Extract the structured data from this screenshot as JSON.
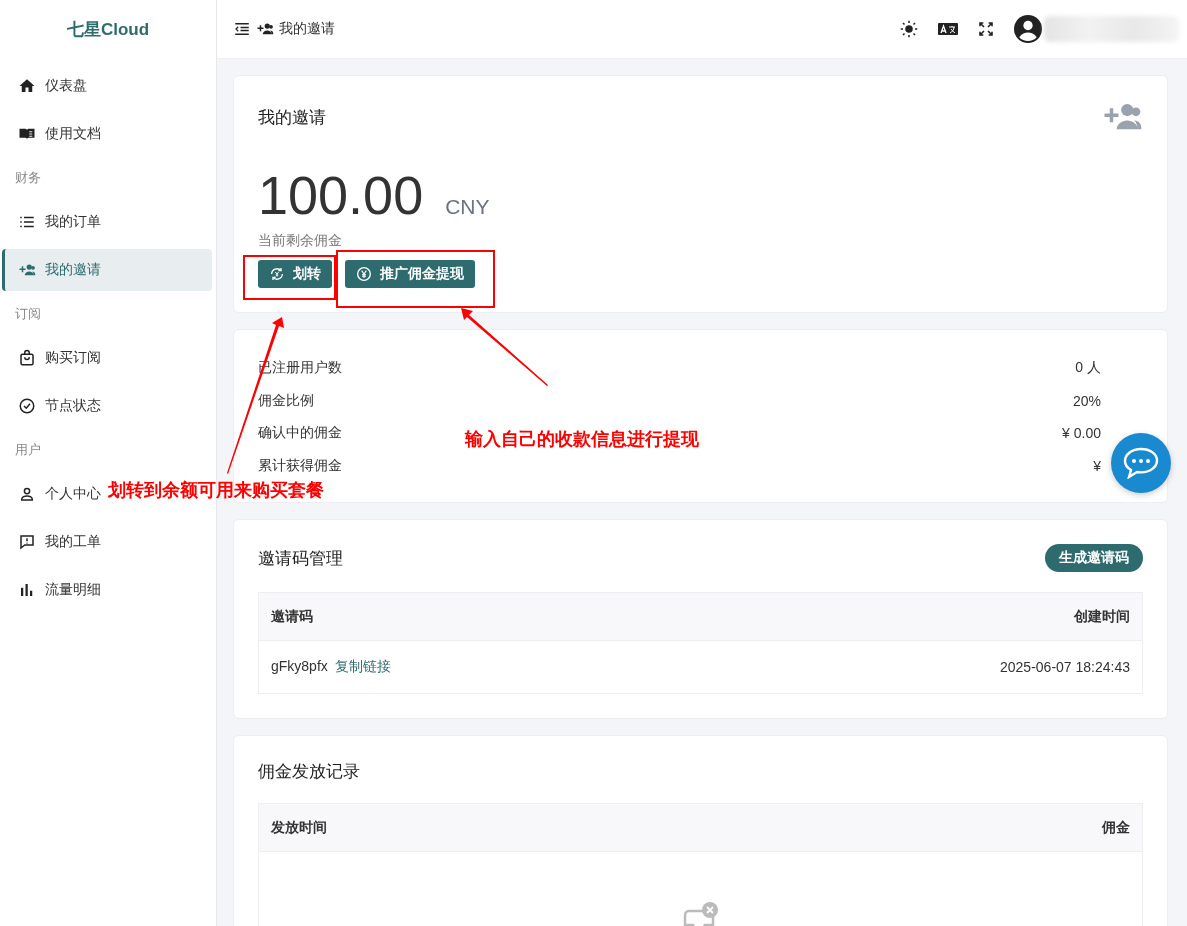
{
  "sidebar": {
    "brand": "七星Cloud",
    "items": [
      {
        "kind": "link",
        "label": "仪表盘",
        "selected": false
      },
      {
        "kind": "link",
        "label": "使用文档",
        "selected": false
      },
      {
        "kind": "section",
        "label": "财务"
      },
      {
        "kind": "link",
        "label": "我的订单",
        "selected": false
      },
      {
        "kind": "link",
        "label": "我的邀请",
        "selected": true
      },
      {
        "kind": "section",
        "label": "订阅"
      },
      {
        "kind": "link",
        "label": "购买订阅",
        "selected": false
      },
      {
        "kind": "link",
        "label": "节点状态",
        "selected": false
      },
      {
        "kind": "section",
        "label": "用户"
      },
      {
        "kind": "link",
        "label": "个人中心",
        "selected": false
      },
      {
        "kind": "link",
        "label": "我的工单",
        "selected": false
      },
      {
        "kind": "link",
        "label": "流量明细",
        "selected": false
      }
    ]
  },
  "header": {
    "breadcrumb": "我的邀请"
  },
  "balance_card": {
    "title": "我的邀请",
    "amount": "100.00",
    "currency": "CNY",
    "caption": "当前剩余佣金",
    "buttons": [
      "划转",
      "推广佣金提现"
    ]
  },
  "stats": [
    {
      "label": "已注册用户数",
      "value": "0 人"
    },
    {
      "label": "佣金比例",
      "value": "20%"
    },
    {
      "label": "确认中的佣金",
      "value": "¥ 0.00"
    },
    {
      "label": "累计获得佣金",
      "value": "¥"
    }
  ],
  "invite_codes": {
    "title": "邀请码管理",
    "button": "生成邀请码",
    "columns": [
      "邀请码",
      "创建时间"
    ],
    "rows": [
      {
        "code": "gFky8pfx",
        "link": "复制链接",
        "created": "2025-06-07 18:24:43"
      }
    ]
  },
  "commission_records": {
    "title": "佣金发放记录",
    "columns": [
      "发放时间",
      "佣金"
    ]
  },
  "annotations": [
    "划转到余额可用来购买套餐",
    "输入自己的收款信息进行提现"
  ]
}
